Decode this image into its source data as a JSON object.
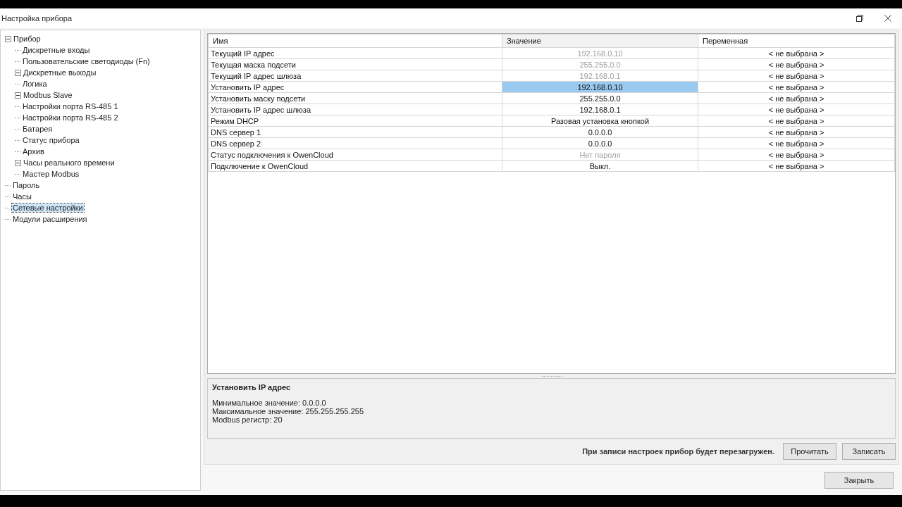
{
  "window": {
    "title": "Настройка прибора"
  },
  "tree": [
    {
      "label": "Прибор",
      "selected": false,
      "expanded": true,
      "children": [
        {
          "label": "Дискретные входы",
          "selected": false
        },
        {
          "label": "Пользовательские светодиоды (Fn)",
          "selected": false
        },
        {
          "label": "Дискретные выходы",
          "selected": false,
          "expanded": true
        },
        {
          "label": "Логика",
          "selected": false
        },
        {
          "label": "Modbus Slave",
          "selected": false,
          "expanded": true
        },
        {
          "label": "Настройки порта RS-485 1",
          "selected": false
        },
        {
          "label": "Настройки порта RS-485 2",
          "selected": false
        },
        {
          "label": "Батарея",
          "selected": false
        },
        {
          "label": "Статус прибора",
          "selected": false
        },
        {
          "label": "Архив",
          "selected": false
        },
        {
          "label": "Часы реального времени",
          "selected": false,
          "expanded": true
        },
        {
          "label": "Мастер Modbus",
          "selected": false
        }
      ]
    },
    {
      "label": "Пароль",
      "selected": false
    },
    {
      "label": "Часы",
      "selected": false
    },
    {
      "label": "Сетевые настройки",
      "selected": true
    },
    {
      "label": "Модули расширения",
      "selected": false
    }
  ],
  "table": {
    "columns": [
      "Имя",
      "Значение",
      "Переменная"
    ],
    "rows": [
      {
        "name": "Текущий IP адрес",
        "value": "192.168.0.10",
        "variable": "< не выбрана >",
        "disabled": true,
        "selected": false
      },
      {
        "name": "Текущая маска подсети",
        "value": "255.255.0.0",
        "variable": "< не выбрана >",
        "disabled": true,
        "selected": false
      },
      {
        "name": "Текущий IP адрес шлюза",
        "value": "192.168.0.1",
        "variable": "< не выбрана >",
        "disabled": true,
        "selected": false
      },
      {
        "name": "Установить IP адрес",
        "value": "192.168.0.10",
        "variable": "< не выбрана >",
        "disabled": false,
        "selected": true
      },
      {
        "name": "Установить маску подсети",
        "value": "255.255.0.0",
        "variable": "< не выбрана >",
        "disabled": false,
        "selected": false
      },
      {
        "name": "Установить IP адрес шлюза",
        "value": "192.168.0.1",
        "variable": "< не выбрана >",
        "disabled": false,
        "selected": false
      },
      {
        "name": "Режим DHCP",
        "value": "Разовая установка кнопкой",
        "variable": "< не выбрана >",
        "disabled": false,
        "selected": false
      },
      {
        "name": "DNS сервер 1",
        "value": "0.0.0.0",
        "variable": "< не выбрана >",
        "disabled": false,
        "selected": false
      },
      {
        "name": "DNS сервер 2",
        "value": "0.0.0.0",
        "variable": "< не выбрана >",
        "disabled": false,
        "selected": false
      },
      {
        "name": "Статус подключения к OwenCloud",
        "value": "Нет пароля",
        "variable": "< не выбрана >",
        "disabled": true,
        "selected": false
      },
      {
        "name": "Подключение к OwenCloud",
        "value": "Выкл.",
        "variable": "< не выбрана >",
        "disabled": false,
        "selected": false
      }
    ]
  },
  "info": {
    "title": "Установить IP адрес",
    "lines": [
      "Минимальное значение: 0.0.0.0",
      "Максимальное значение: 255.255.255.255",
      "Modbus регистр: 20"
    ]
  },
  "footer": {
    "note": "При записи настроек прибор будет перезагружен.",
    "buttons": [
      "Прочитать",
      "Записать"
    ]
  },
  "close_button": "Закрыть"
}
